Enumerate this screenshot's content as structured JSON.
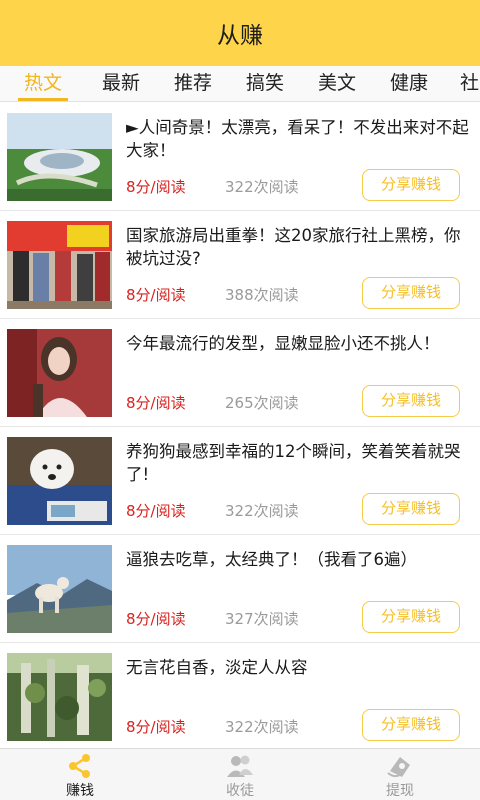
{
  "header": {
    "title": "从赚"
  },
  "tabs": [
    "热文",
    "最新",
    "推荐",
    "搞笑",
    "美文",
    "健康",
    "社"
  ],
  "articles": [
    {
      "title": "►人间奇景！太漂亮，看呆了！不发出来对不起大家！",
      "rate": "8分/阅读",
      "reads": "322次阅读",
      "share": "分享赚钱"
    },
    {
      "title": "国家旅游局出重拳！这20家旅行社上黑榜，你被坑过没?",
      "rate": "8分/阅读",
      "reads": "388次阅读",
      "share": "分享赚钱"
    },
    {
      "title": "今年最流行的发型，显嫩显脸小还不挑人！",
      "rate": "8分/阅读",
      "reads": "265次阅读",
      "share": "分享赚钱"
    },
    {
      "title": "养狗狗最感到幸福的12个瞬间，笑着笑着就哭了!",
      "rate": "8分/阅读",
      "reads": "322次阅读",
      "share": "分享赚钱"
    },
    {
      "title": "逼狼去吃草，太经典了！（我看了6遍）",
      "rate": "8分/阅读",
      "reads": "327次阅读",
      "share": "分享赚钱"
    },
    {
      "title": "无言花自香，淡定人从容",
      "rate": "8分/阅读",
      "reads": "322次阅读",
      "share": "分享赚钱"
    }
  ],
  "bottom_nav": [
    {
      "label": "赚钱",
      "icon": "share-icon",
      "active": true
    },
    {
      "label": "收徒",
      "icon": "users-icon",
      "active": false
    },
    {
      "label": "提现",
      "icon": "wallet-icon",
      "active": false
    }
  ],
  "colors": {
    "brand_yellow": "#fed44b",
    "active_tab": "#f2b61e",
    "rate_red": "#d8231f",
    "share_border": "#f6cb4a"
  }
}
